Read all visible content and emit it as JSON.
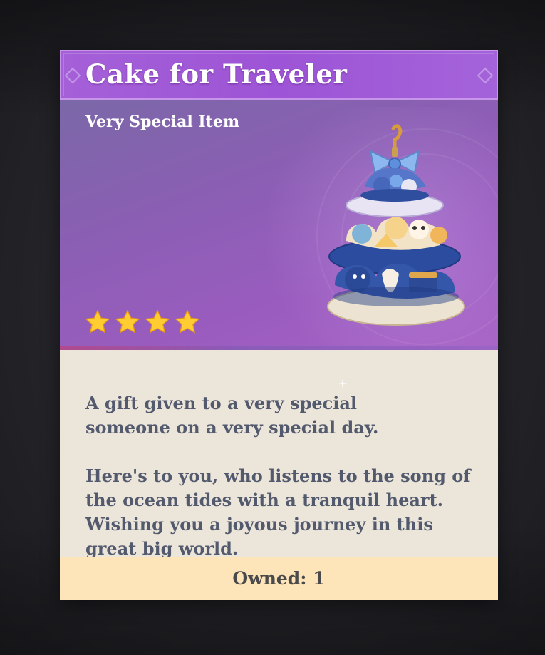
{
  "item": {
    "name": "Cake for Traveler",
    "type": "Very Special Item",
    "rarity_stars": 4,
    "description": [
      "A gift given to a very special someone on a very special day.",
      "Here's to you, who listens to the song of the ocean tides with a tranquil heart.",
      "Wishing you a joyous journey in this great big world."
    ],
    "owned_label": "Owned: 1"
  },
  "icons": {
    "item": "tiered-cake-icon",
    "rarity": "star-icon"
  },
  "colors": {
    "title_bar": "#9d54d6",
    "hero_bg": "#8a5fb3",
    "desc_bg": "#ece5da",
    "desc_text": "#535a6e",
    "owned_bg": "#fde5b9",
    "star": "#ffcc32"
  }
}
